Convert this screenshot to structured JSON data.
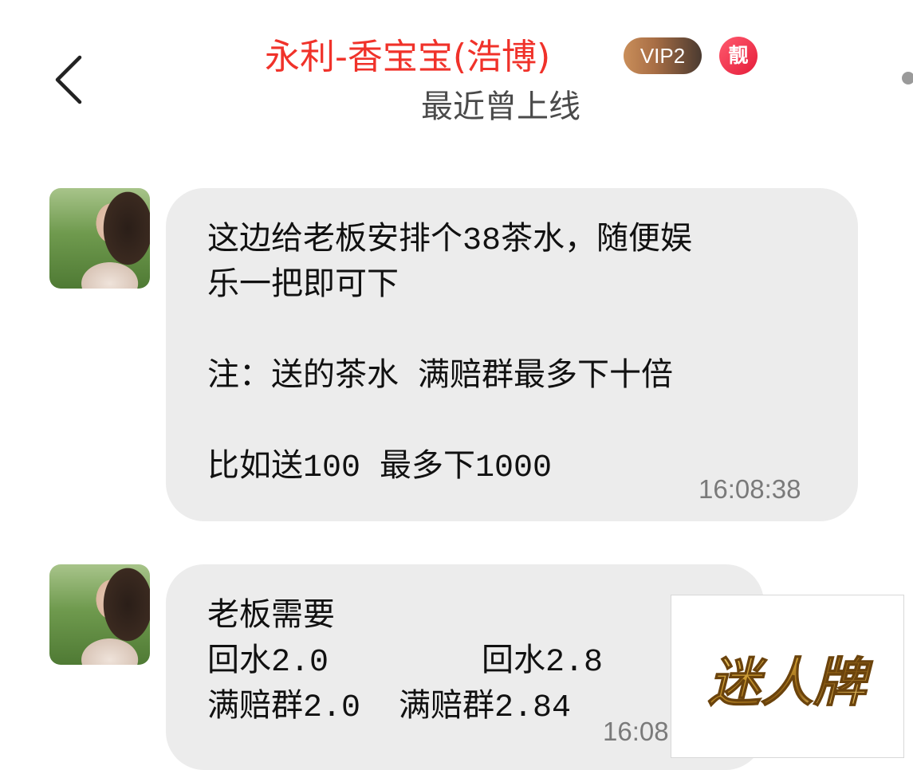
{
  "header": {
    "title": "永利-香宝宝(浩博)",
    "vip_badge": "VIP2",
    "pretty_badge": "靓",
    "status": "最近曾上线"
  },
  "messages": [
    {
      "text": "这边给老板安排个38茶水，随便娱\n乐一把即可下\n\n注：送的茶水 满赔群最多下十倍\n\n比如送100 最多下1000",
      "time": "16:08:38"
    },
    {
      "text": "老板需要\n回水2.0        回水2.8\n满赔群2.0  满赔群2.84",
      "time": "16:08"
    }
  ],
  "watermark": {
    "text": "迷人牌"
  },
  "colors": {
    "title": "#f0322a",
    "bubble": "#ececec",
    "vip_gradient_start": "#c98e5a",
    "pretty_badge": "#e51d3a",
    "watermark_gold": "#c9972e"
  },
  "icons": {
    "back": "chevron-left-icon",
    "menu": "more-dot-icon"
  }
}
